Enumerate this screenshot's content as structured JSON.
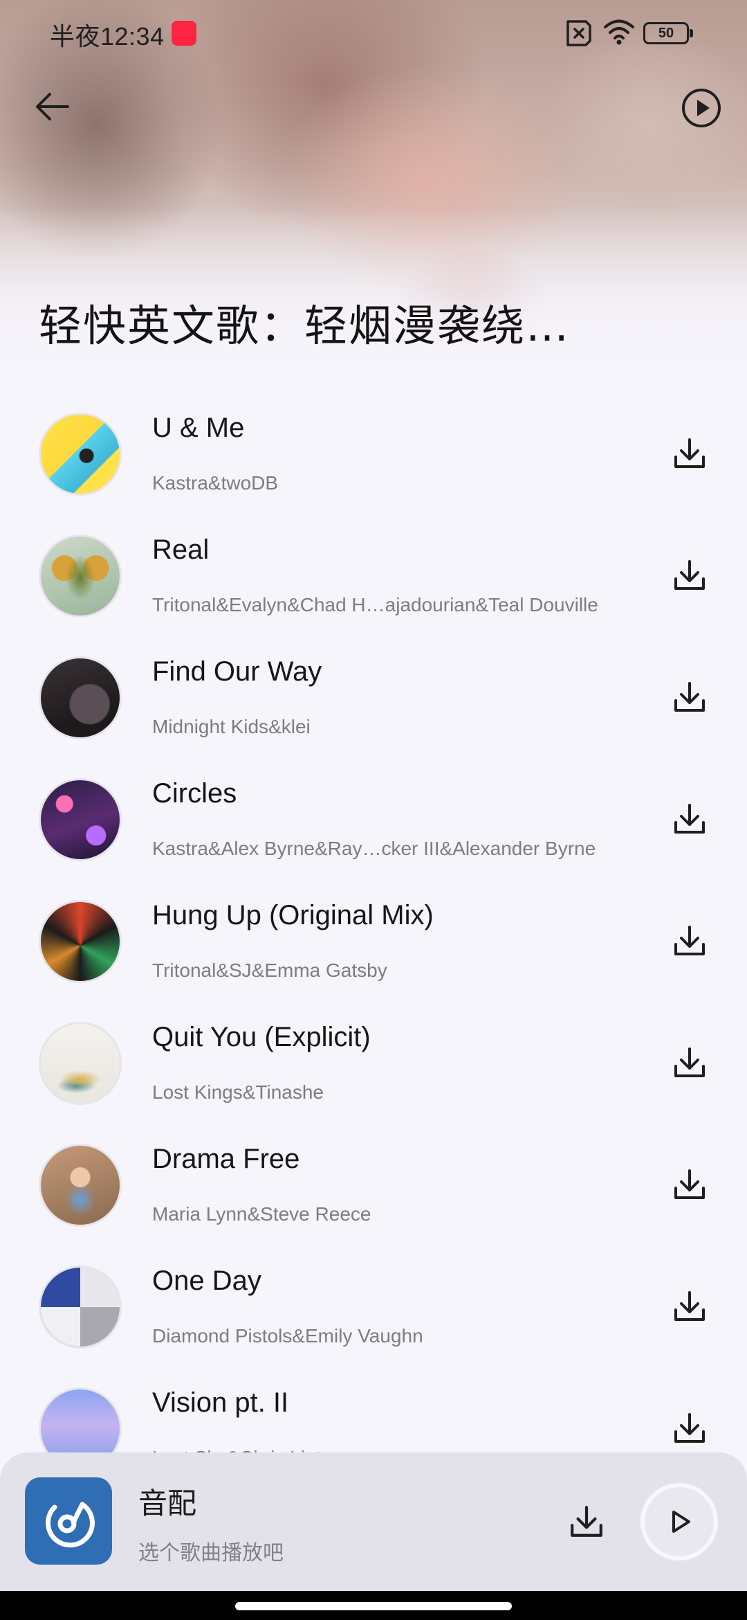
{
  "status_bar": {
    "time": "半夜12:34",
    "app_badge": "小红书",
    "battery": "50",
    "icons": [
      "sim-off-icon",
      "wifi-icon",
      "battery-icon"
    ]
  },
  "header": {
    "back_icon": "back-arrow-icon",
    "play_all_icon": "play-circle-icon",
    "title": "轻快英文歌：轻烟漫袭绕…"
  },
  "songs": [
    {
      "title": "U & Me",
      "artist": "Kastra&twoDB"
    },
    {
      "title": "Real",
      "artist": "Tritonal&Evalyn&Chad H…ajadourian&Teal Douville"
    },
    {
      "title": "Find Our Way",
      "artist": "Midnight Kids&klei"
    },
    {
      "title": "Circles",
      "artist": "Kastra&Alex Byrne&Ray…cker III&Alexander Byrne"
    },
    {
      "title": "Hung Up (Original Mix)",
      "artist": "Tritonal&SJ&Emma Gatsby"
    },
    {
      "title": "Quit You (Explicit)",
      "artist": "Lost Kings&Tinashe"
    },
    {
      "title": "Drama Free",
      "artist": "Maria Lynn&Steve Reece"
    },
    {
      "title": "One Day",
      "artist": "Diamond Pistols&Emily Vaughn"
    },
    {
      "title": "Vision pt. II",
      "artist": "Lost Sky&Chris Linton"
    }
  ],
  "player": {
    "app_name": "音配",
    "hint": "选个歌曲播放吧",
    "download_icon": "download-icon",
    "play_icon": "play-icon"
  },
  "colors": {
    "background": "#f6f5fb",
    "player_bar": "#e3e2eb",
    "logo": "#2f6db5",
    "secondary_text": "#7c7c82"
  }
}
